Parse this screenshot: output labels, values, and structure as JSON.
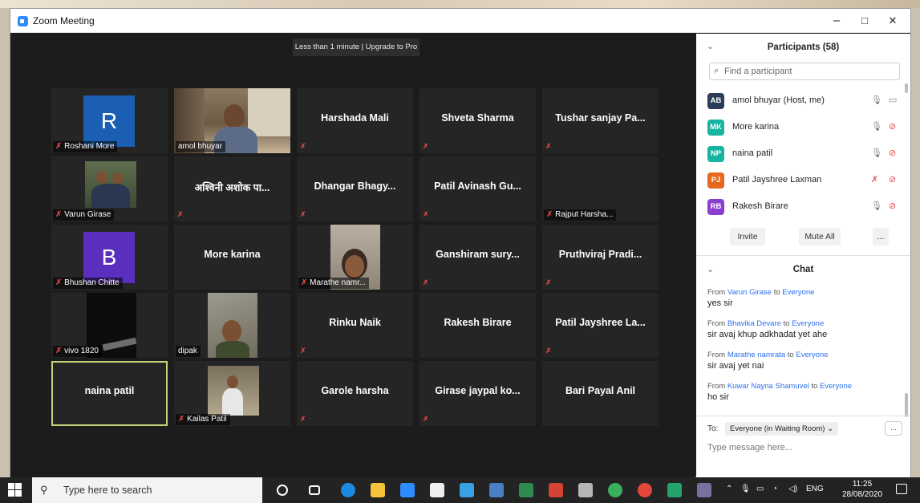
{
  "window": {
    "title": "Zoom Meeting",
    "minimize": "–",
    "maximize": "□",
    "close": "✕"
  },
  "recording_banner": "Less than 1 minute | Upgrade to Pro",
  "tiles": [
    "Roshani More",
    "amol bhuyar",
    "Harshada Mali",
    "Shveta Sharma",
    "Tushar sanjay Pa...",
    "Varun Girase",
    "अश्विनी अशोक पा...",
    "Dhangar Bhagy...",
    "Patil Avinash Gu...",
    "Rajput Harsha...",
    "Bhushan Chitte",
    "More karina",
    "Marathe namr...",
    "Ganshiram sury...",
    "Pruthviraj Pradi...",
    "vivo 1820",
    "dipak",
    "Rinku Naik",
    "Rakesh Birare",
    "Patil Jayshree La...",
    "naina patil",
    "Kailas Patil",
    "Garole harsha",
    "Girase jaypal ko...",
    "Bari Payal Anil"
  ],
  "avatars": {
    "r": "R",
    "b": "B"
  },
  "participants": {
    "title": "Participants (58)",
    "search_placeholder": "Find a participant",
    "list": [
      {
        "initials": "AB",
        "name": "amol bhuyar (Host, me)",
        "color": "#2a3c57"
      },
      {
        "initials": "MK",
        "name": "More karina",
        "color": "#16b4a1"
      },
      {
        "initials": "NP",
        "name": "naina patil",
        "color": "#16b4a1"
      },
      {
        "initials": "PJ",
        "name": "Patil Jayshree Laxman",
        "color": "#e5681d"
      },
      {
        "initials": "RB",
        "name": "Rakesh Birare",
        "color": "#8a3fd1"
      }
    ],
    "invite": "Invite",
    "mute_all": "Mute All",
    "more": "..."
  },
  "chat": {
    "title": "Chat",
    "messages": [
      {
        "from": "Varun Girase",
        "to": "Everyone",
        "text": "yes sir"
      },
      {
        "from": "Bhavika Devare",
        "to": "Everyone",
        "text": "sir avaj khup adkhadat yet ahe"
      },
      {
        "from": "Marathe namrata",
        "to": "Everyone",
        "text": "sir avaj yet nai"
      },
      {
        "from": "Kuwar Nayna Shamuvel",
        "to": "Everyone",
        "text": "ho sir"
      }
    ],
    "from_word": "From",
    "to_word": "to",
    "to_label": "To:",
    "to_value": "Everyone (in Waiting Room) ⌄",
    "input_placeholder": "Type message here...",
    "more": "..."
  },
  "taskbar": {
    "search_placeholder": "Type here to search",
    "lang": "ENG",
    "time": "11:25",
    "date": "28/08/2020"
  },
  "icons": [
    "zoom-icon",
    "search-icon",
    "microphone-muted-icon",
    "camera-off-icon",
    "windows-start-icon"
  ]
}
